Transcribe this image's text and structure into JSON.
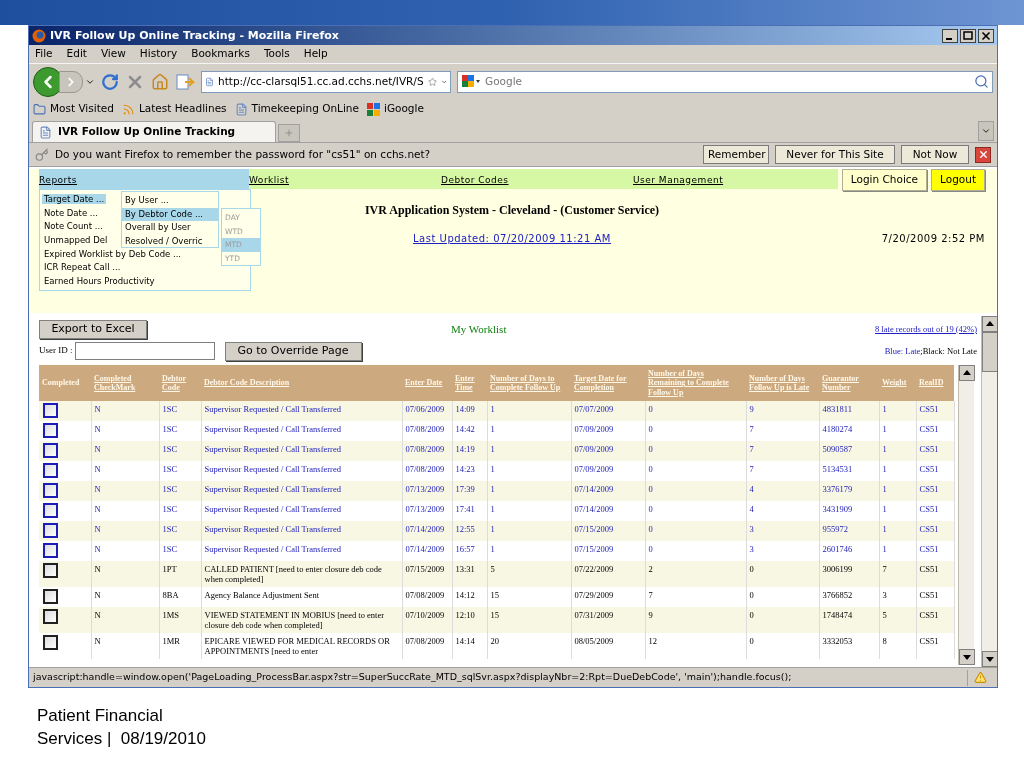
{
  "slide": {
    "footer": [
      "Patient Financial",
      "Services |  08/19/2010"
    ]
  },
  "window": {
    "title": "IVR Follow Up Online Tracking - Mozilla Firefox"
  },
  "menu_bar": [
    "File",
    "Edit",
    "View",
    "History",
    "Bookmarks",
    "Tools",
    "Help"
  ],
  "nav_toolbar": {
    "url": "http://cc-clarsql51.cc.ad.cchs.net/IVR/S",
    "search_placeholder": "Google"
  },
  "bookmarks": [
    "Most Visited",
    "Latest Headlines",
    "Timekeeping OnLine",
    "iGoogle"
  ],
  "tabs": [
    {
      "label": "IVR Follow Up Online Tracking",
      "selected": true
    }
  ],
  "notification": {
    "message": "Do you want Firefox to remember the password for \"cs51\" on cchs.net?",
    "buttons": [
      "Remember",
      "Never for This Site",
      "Not Now"
    ]
  },
  "page": {
    "nav": [
      {
        "label": "Reports",
        "selected": true
      },
      {
        "label": "Worklist",
        "selected": false
      },
      {
        "label": "Debtor Codes",
        "selected": false
      },
      {
        "label": "User Management",
        "selected": false
      }
    ],
    "header_buttons": [
      {
        "label": "Login Choice",
        "kind": "plain"
      },
      {
        "label": "Logout",
        "kind": "highlight"
      }
    ],
    "title": "IVR Application System - Cleveland - (Customer Service)",
    "last_updated": "Last Updated: 07/20/2009 11:21 AM",
    "datetime": "7/20/2009 2:52 PM",
    "reports_menu": [
      {
        "label": "Target Date ...",
        "selected": true
      },
      {
        "label": "Note Date ...",
        "selected": false
      },
      {
        "label": "Note Count ...",
        "selected": false
      },
      {
        "label": "Unmapped Del",
        "selected": false
      },
      {
        "label": "Expired Worklist by Deb Code ...",
        "selected": false
      },
      {
        "label": "ICR Repeat Call ...",
        "selected": false
      },
      {
        "label": "Earned Hours Productivity",
        "selected": false
      }
    ],
    "target_submenu": [
      {
        "label": "By User ...",
        "selected": false
      },
      {
        "label": "By Debtor Code ...",
        "selected": true
      },
      {
        "label": "Overall by User",
        "selected": false
      },
      {
        "label": "Resolved / Overric",
        "selected": false
      }
    ],
    "period_submenu": [
      {
        "label": "DAY",
        "selected": false
      },
      {
        "label": "WTD",
        "selected": false
      },
      {
        "label": "MTD",
        "selected": true
      },
      {
        "label": "YTD",
        "selected": false
      }
    ],
    "export_button": "Export to Excel",
    "worklist_title": "My Worklist",
    "late_summary": "8 late records out of 19 (42%)",
    "user_id_label": "User ID :",
    "override_button": "Go to Override Page",
    "legend": [
      {
        "label": "Blue: Late",
        "late": true
      },
      {
        "label": ";Black: Not Late",
        "late": false
      }
    ],
    "table": {
      "checkbox_column": "Completed",
      "columns": [
        "Completed CheckMark",
        "Debtor Code",
        "Debtor Code Description",
        "Enter Date",
        "Enter Time",
        "Number of Days to Complete Follow Up",
        "Target Date for Completion",
        "Number of Days Remaining to Complete Follow Up",
        "Number of Days Follow Up is Late",
        "Guarantor Number",
        "Weight",
        "RealID"
      ],
      "rows": [
        {
          "late": true,
          "checked": false,
          "cells": [
            "N",
            "1SC",
            "Supervisor Requested / Call Transferred",
            "07/06/2009",
            "14:09",
            "1",
            "07/07/2009",
            "0",
            "9",
            "4831811",
            "1",
            "CS51"
          ]
        },
        {
          "late": true,
          "checked": false,
          "cells": [
            "N",
            "1SC",
            "Supervisor Requested / Call Transferred",
            "07/08/2009",
            "14:42",
            "1",
            "07/09/2009",
            "0",
            "7",
            "4180274",
            "1",
            "CS51"
          ]
        },
        {
          "late": true,
          "checked": false,
          "cells": [
            "N",
            "1SC",
            "Supervisor Requested / Call Transferred",
            "07/08/2009",
            "14:19",
            "1",
            "07/09/2009",
            "0",
            "7",
            "5090587",
            "1",
            "CS51"
          ]
        },
        {
          "late": true,
          "checked": false,
          "cells": [
            "N",
            "1SC",
            "Supervisor Requested / Call Transferred",
            "07/08/2009",
            "14:23",
            "1",
            "07/09/2009",
            "0",
            "7",
            "5134531",
            "1",
            "CS51"
          ]
        },
        {
          "late": true,
          "checked": false,
          "cells": [
            "N",
            "1SC",
            "Supervisor Requested / Call Transferred",
            "07/13/2009",
            "17:39",
            "1",
            "07/14/2009",
            "0",
            "4",
            "3376179",
            "1",
            "CS51"
          ]
        },
        {
          "late": true,
          "checked": false,
          "cells": [
            "N",
            "1SC",
            "Supervisor Requested / Call Transferred",
            "07/13/2009",
            "17:41",
            "1",
            "07/14/2009",
            "0",
            "4",
            "3431909",
            "1",
            "CS51"
          ]
        },
        {
          "late": true,
          "checked": false,
          "cells": [
            "N",
            "1SC",
            "Supervisor Requested / Call Transferred",
            "07/14/2009",
            "12:55",
            "1",
            "07/15/2009",
            "0",
            "3",
            "955972",
            "1",
            "CS51"
          ]
        },
        {
          "late": true,
          "checked": false,
          "cells": [
            "N",
            "1SC",
            "Supervisor Requested / Call Transferred",
            "07/14/2009",
            "16:57",
            "1",
            "07/15/2009",
            "0",
            "3",
            "2601746",
            "1",
            "CS51"
          ]
        },
        {
          "late": false,
          "checked": false,
          "cells": [
            "N",
            "1PT",
            "CALLED PATIENT [need to enter closure deb code when completed]",
            "07/15/2009",
            "13:31",
            "5",
            "07/22/2009",
            "2",
            "0",
            "3006199",
            "7",
            "CS51"
          ]
        },
        {
          "late": false,
          "checked": false,
          "cells": [
            "N",
            "8BA",
            "Agency Balance Adjustment Sent",
            "07/08/2009",
            "14:12",
            "15",
            "07/29/2009",
            "7",
            "0",
            "3766852",
            "3",
            "CS51"
          ]
        },
        {
          "late": false,
          "checked": false,
          "cells": [
            "N",
            "1MS",
            "VIEWED STATEMENT IN MOBIUS [need to enter closure deb code when completed]",
            "07/10/2009",
            "12:10",
            "15",
            "07/31/2009",
            "9",
            "0",
            "1748474",
            "5",
            "CS51"
          ]
        },
        {
          "late": false,
          "checked": false,
          "cells": [
            "N",
            "1MR",
            "EPICARE VIEWED FOR MEDICAL RECORDS OR APPOINTMENTS [need to enter",
            "07/08/2009",
            "14:14",
            "20",
            "08/05/2009",
            "12",
            "0",
            "3332053",
            "8",
            "CS51"
          ]
        }
      ]
    }
  },
  "status_bar": "javascript:handle=window.open('PageLoading_ProcessBar.aspx?str=SuperSuccRate_MTD_sqlSvr.aspx?displayNbr=2:Rpt=DueDebCode', 'main');handle.focus();"
}
